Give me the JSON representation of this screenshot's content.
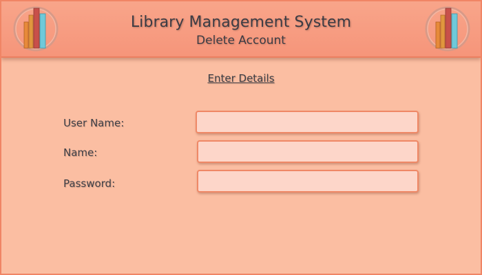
{
  "header": {
    "title": "Library Management System",
    "subtitle": "Delete Account",
    "logo_icon": "books-icon"
  },
  "form": {
    "heading": "Enter Details",
    "fields": [
      {
        "label": "User Name:",
        "value": "",
        "placeholder": ""
      },
      {
        "label": "Name:",
        "value": "",
        "placeholder": ""
      },
      {
        "label": "Password:",
        "value": "",
        "placeholder": ""
      }
    ]
  },
  "colors": {
    "background": "#fbbea2",
    "header": "#f8a58a",
    "border": "#f08565",
    "input_fill": "#fdd6c9",
    "text": "#3c3c44"
  }
}
